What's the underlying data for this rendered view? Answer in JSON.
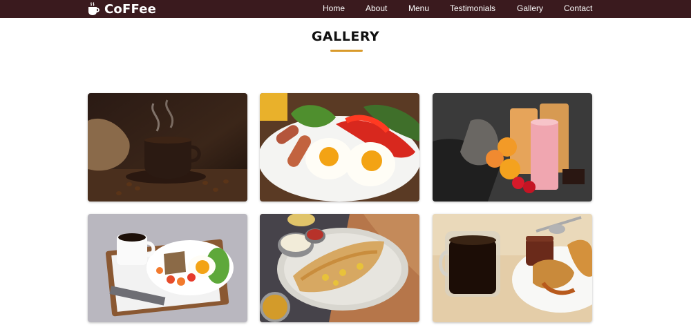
{
  "brand": {
    "name": "CoFFee",
    "logo_icon": "coffee-cup-icon"
  },
  "nav": {
    "items": [
      {
        "label": "Home"
      },
      {
        "label": "About"
      },
      {
        "label": "Menu"
      },
      {
        "label": "Testimonials"
      },
      {
        "label": "Gallery"
      },
      {
        "label": "Contact"
      }
    ]
  },
  "section": {
    "title": "GALLERY",
    "accent_color": "#d99a2b"
  },
  "colors": {
    "navbar_bg": "#3a1a1e",
    "background": "#ffffff"
  },
  "gallery": {
    "images": [
      {
        "name": "coffee-cup-with-beans-photo"
      },
      {
        "name": "breakfast-eggs-sausages-photo"
      },
      {
        "name": "fruit-smoothies-photo"
      },
      {
        "name": "breakfast-tray-with-coffee-photo"
      },
      {
        "name": "dosa-with-chutney-photo"
      },
      {
        "name": "coffee-and-croissant-photo"
      }
    ]
  }
}
